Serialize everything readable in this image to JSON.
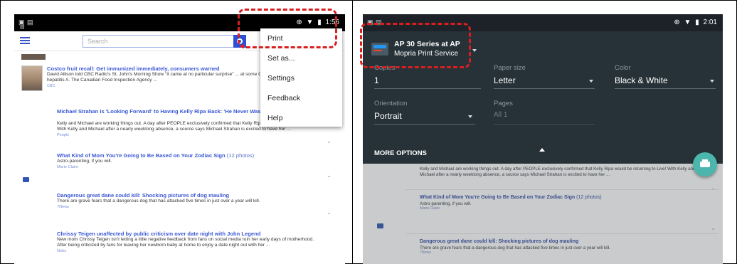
{
  "left_screen": {
    "status": {
      "time": "1:56"
    },
    "search": {
      "placeholder": "Search"
    },
    "menu": {
      "items": [
        "Print",
        "Set as...",
        "Settings",
        "Feedback",
        "Help"
      ]
    },
    "articles": [
      {
        "headline": "Costco fruit recall: Get immunized immediately, consumers warned",
        "body": "David Allison told CBC Radio's St. John's Morning Show \"it came at no particular surprise\" ... at some Costco stores was linked to hepatitis A. The Canadian Food Inspection Agency ...",
        "source": "CBC"
      },
      {
        "headline": "Michael Strahan Is 'Looking Forward' to Having Kelly Ripa Back: 'He Never Was Happier,' Says Source",
        "body": "Kelly and Michael are working things out. A day after PEOPLE exclusively confirmed that Kelly Ripa would be returning to Live! With Kelly and Michael after a nearly weeklong absence, a source says Michael Strahan is excited to have her ...",
        "source": "People"
      },
      {
        "headline": "What Kind of Mom You're Going to Be Based on Your Zodiac Sign",
        "headline_suffix": "(12 photos)",
        "body": "Astro-parenting, if you will.",
        "source": "Marie Claire"
      },
      {
        "headline": "Dangerous great dane could kill: Shocking pictures of dog mauling",
        "body": "There are grave fears that a dangerous dog that has attacked five times in just over a year will kill.",
        "source": "7News"
      },
      {
        "headline": "Chrissy Teigen unaffected by public criticism over date night with John Legend",
        "body": "New mom Chrissy Teigen isn't letting a little negative feedback from fans on social media ruin her early days of motherhood. After being criticized by fans for leaving her newborn baby at home to enjoy a date night out with her ...",
        "source": "Nebo"
      }
    ]
  },
  "right_screen": {
    "status": {
      "time": "2:01"
    },
    "printer": {
      "name": "AP 30 Series at AP",
      "service": "Mopria Print Service"
    },
    "options": {
      "copies_label": "Copies",
      "copies_value": "1",
      "paper_label": "Paper size",
      "paper_value": "Letter",
      "color_label": "Color",
      "color_value": "Black & White",
      "orientation_label": "Orientation",
      "orientation_value": "Portrait",
      "pages_label": "Pages",
      "pages_value": "All 1"
    },
    "more_options": "MORE OPTIONS",
    "articles": [
      {
        "body": "Kelly and Michael are working things out. A day after PEOPLE exclusively confirmed that Kelly Ripa would be returning to Live! With Kelly and Michael after a nearly weeklong absence, a source says Michael Strahan is excited to have her ..."
      },
      {
        "headline": "What Kind of Mom You're Going to Be Based on Your Zodiac Sign",
        "headline_suffix": "(12 photos)",
        "body": "Astro-parenting, if you will.",
        "source": "Marie Claire"
      },
      {
        "headline": "Dangerous great dane could kill: Shocking pictures of dog mauling",
        "body": "There are grave fears that a dangerous dog that has attacked five times in just over a year will kill.",
        "source": "7News"
      }
    ]
  },
  "colors": {
    "highlight_dash": "#d81f1f",
    "link_blue": "#3b58d4",
    "print_sheet_bg": "#263238",
    "fab_teal": "#4db6ac"
  }
}
